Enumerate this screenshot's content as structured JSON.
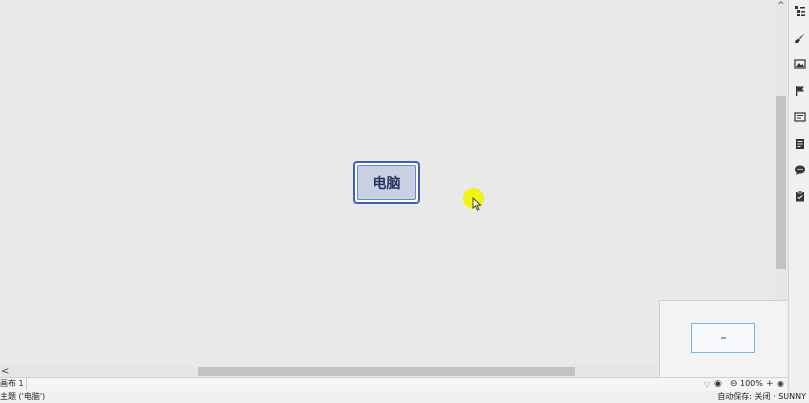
{
  "topic": {
    "label": "电脑"
  },
  "sheet": {
    "tab_label": "画布 1",
    "zoom_level": "100%"
  },
  "status": {
    "selection": "主题 ('电脑')",
    "autosave": "自动保存: 关闭",
    "user": "SUNNY"
  },
  "icons": {
    "toolbar": [
      "outline-icon",
      "brush-icon",
      "image-icon",
      "flag-icon",
      "text-icon",
      "notes-icon",
      "comment-icon",
      "clipboard-icon"
    ],
    "bottom": [
      "filter-icon",
      "eye-icon",
      "zoom-out-icon",
      "zoom-in-icon",
      "fit-icon"
    ]
  },
  "colors": {
    "topic_border": "#3f62b4",
    "topic_fill": "#c9d0e3",
    "cursor_highlight": "#f2f20a",
    "accent": "#2f73c0"
  }
}
